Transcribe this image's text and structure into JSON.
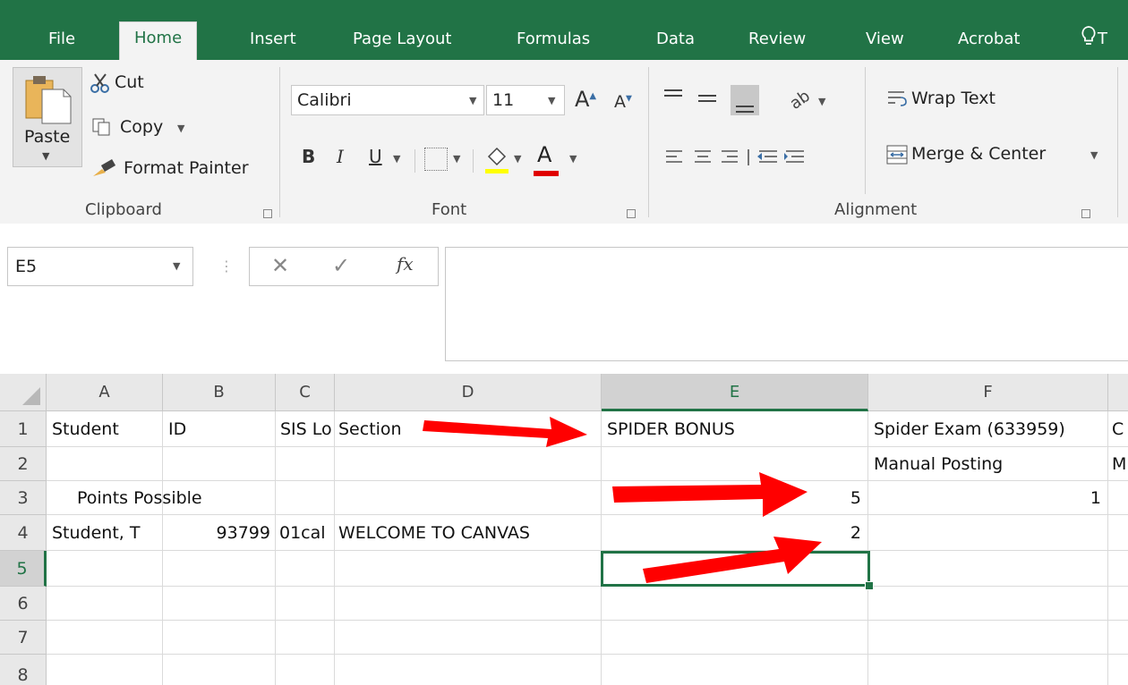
{
  "tabs": [
    "File",
    "Home",
    "Insert",
    "Page Layout",
    "Formulas",
    "Data",
    "Review",
    "View",
    "Acrobat",
    "T"
  ],
  "clipboard": {
    "paste": "Paste",
    "cut": "Cut",
    "copy": "Copy",
    "format_painter": "Format Painter",
    "label": "Clipboard"
  },
  "font": {
    "name": "Calibri",
    "size": "11",
    "bold": "B",
    "italic": "I",
    "underline": "U",
    "grow": "A",
    "shrink": "A",
    "font_color": "A",
    "label": "Font"
  },
  "alignment": {
    "wrap_text": "Wrap Text",
    "merge_center": "Merge & Center",
    "label": "Alignment"
  },
  "formula_bar": {
    "name_box": "E5",
    "fx": "fx",
    "value": ""
  },
  "grid": {
    "columns": [
      "A",
      "B",
      "C",
      "D",
      "E",
      "F"
    ],
    "rows": [
      "1",
      "2",
      "3",
      "4",
      "5",
      "6",
      "7",
      "8"
    ],
    "cells": {
      "r1": {
        "A": "Student",
        "B": "ID",
        "C": "SIS Lo",
        "D": "Section",
        "E": "SPIDER BONUS",
        "F": "Spider Exam (633959)",
        "G": "C"
      },
      "r2": {
        "F": "Manual Posting",
        "G": "M"
      },
      "r3": {
        "A": "Points Possible",
        "E": "5",
        "F": "1"
      },
      "r4": {
        "A": "Student, T",
        "B": "93799",
        "C": "01cal",
        "D": "WELCOME TO CANVAS",
        "E": "2"
      }
    }
  },
  "colors": {
    "excel_green": "#217346",
    "annotation_red": "#ff0000"
  }
}
